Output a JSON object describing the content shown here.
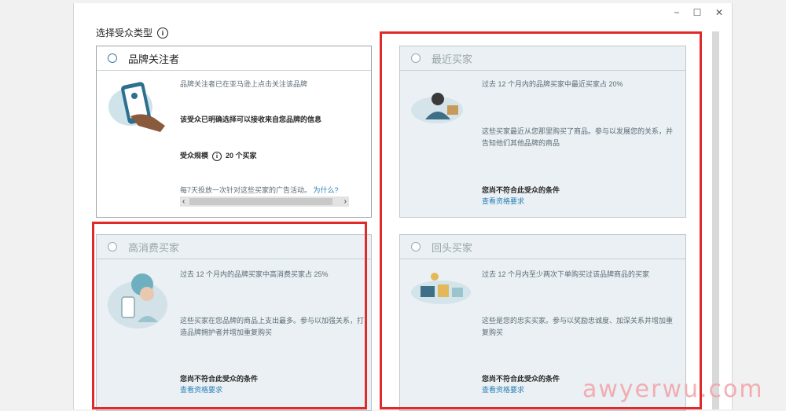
{
  "window": {
    "minimize": "−",
    "maximize": "☐",
    "close": "✕"
  },
  "heading": {
    "text": "选择受众类型",
    "info": "i"
  },
  "brand_followers": {
    "title": "品牌关注者",
    "desc": "品牌关注者已在亚马逊上点击关注该品牌",
    "opt_in": "该受众已明确选择可以接收来自您品牌的信息",
    "size_label": "受众规模",
    "size_value": "20 个买家",
    "footer": "每7天投放一次针对这些买家的广告活动。",
    "why": "为什么?",
    "scroll_left": "‹",
    "scroll_right": "›"
  },
  "recent_buyers": {
    "title": "最近买家",
    "desc": "过去 12 个月内的品牌买家中最近买家占 20%",
    "body": "这些买家最近从您那里购买了商品。参与以发展您的关系，并告知他们其他品牌的商品",
    "ineligible": "您尚不符合此受众的条件",
    "requirements": "查看资格要求"
  },
  "high_spend": {
    "title": "高消费买家",
    "desc": "过去 12 个月内的品牌买家中高消费买家占 25%",
    "body": "这些买家在您品牌的商品上支出最多。参与以加强关系，打造品牌拥护者并增加重复购买",
    "ineligible": "您尚不符合此受众的条件",
    "requirements": "查看资格要求"
  },
  "repeat_buyers": {
    "title": "回头买家",
    "desc": "过去 12 个月内至少两次下单购买过该品牌商品的买家",
    "body": "这些是您的忠实买家。参与以奖励忠诚度、加深关系并增加重复购买",
    "ineligible": "您尚不符合此受众的条件",
    "requirements": "查看资格要求"
  },
  "watermark": "awyerwu.com",
  "colors": {
    "highlight": "#e02a2a",
    "link": "#2a7fb8",
    "card_bg": "#eaf0f3"
  }
}
